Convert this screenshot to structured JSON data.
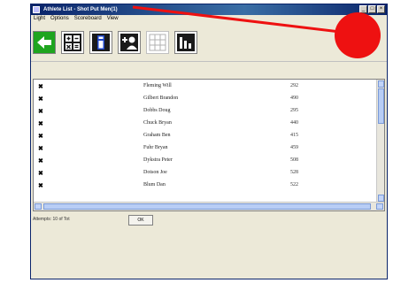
{
  "window": {
    "title": "Athlete List - Shot Put Men(1)",
    "buttons": [
      "_",
      "□",
      "×"
    ]
  },
  "menu": [
    "Light",
    "Options",
    "Scoreboard",
    "View"
  ],
  "toolbar": {
    "buttons": [
      {
        "name": "back",
        "color": "#1ea51e"
      },
      {
        "name": "calculator",
        "color": "#1a1a1a"
      },
      {
        "name": "info",
        "color": "#1e46c8"
      },
      {
        "name": "add-athlete",
        "color": "#1a1a1a"
      },
      {
        "name": "grid-disabled",
        "color": "#b0b0b0"
      },
      {
        "name": "bars",
        "color": "#1a1a1a"
      }
    ]
  },
  "rows": [
    {
      "mark": "✖",
      "name": "Fleming Will",
      "num": "292"
    },
    {
      "mark": "✖",
      "name": "Gilbert Brandon",
      "num": "490"
    },
    {
      "mark": "✖",
      "name": "Dobbs Doug",
      "num": "295"
    },
    {
      "mark": "✖",
      "name": "Chuck Bryan",
      "num": "440"
    },
    {
      "mark": "✖",
      "name": "Graham Ben",
      "num": "415"
    },
    {
      "mark": "✖",
      "name": "Fuhr Bryan",
      "num": "459"
    },
    {
      "mark": "✖",
      "name": "Dykstra Peter",
      "num": "508"
    },
    {
      "mark": "✖",
      "name": "Dotson Joe",
      "num": "528"
    },
    {
      "mark": "✖",
      "name": "Blum Dan",
      "num": "522"
    }
  ],
  "status": {
    "label": "Attempts: 10 of Tot",
    "ok_label": "OK"
  },
  "annotation": {
    "arrow_color": "#ee1111"
  }
}
